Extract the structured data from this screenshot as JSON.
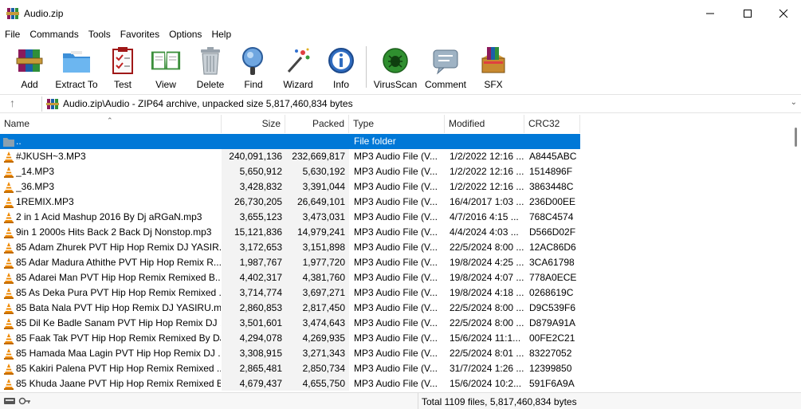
{
  "window": {
    "title": "Audio.zip"
  },
  "menu": [
    "File",
    "Commands",
    "Tools",
    "Favorites",
    "Options",
    "Help"
  ],
  "toolbar": [
    {
      "label": "Add",
      "icon": "add-archive-icon"
    },
    {
      "label": "Extract To",
      "icon": "extract-folder-icon"
    },
    {
      "label": "Test",
      "icon": "test-clipboard-icon"
    },
    {
      "label": "View",
      "icon": "view-book-icon"
    },
    {
      "label": "Delete",
      "icon": "trash-icon"
    },
    {
      "label": "Find",
      "icon": "magnifier-icon"
    },
    {
      "label": "Wizard",
      "icon": "wizard-wand-icon"
    },
    {
      "label": "Info",
      "icon": "info-icon"
    },
    {
      "label": "VirusScan",
      "icon": "virus-scan-icon"
    },
    {
      "label": "Comment",
      "icon": "comment-icon"
    },
    {
      "label": "SFX",
      "icon": "sfx-box-icon"
    }
  ],
  "path": {
    "text": "Audio.zip\\Audio - ZIP64 archive, unpacked size 5,817,460,834 bytes"
  },
  "columns": {
    "name": "Name",
    "size": "Size",
    "packed": "Packed",
    "type": "Type",
    "modified": "Modified",
    "crc": "CRC32"
  },
  "parent_row": {
    "name": "..",
    "type": "File folder"
  },
  "files": [
    {
      "name": "#JKUSH~3.MP3",
      "size": "240,091,136",
      "packed": "232,669,817",
      "type": "MP3 Audio File (V...",
      "modified": "1/2/2022 12:16 ...",
      "crc": "A8445ABC"
    },
    {
      "name": "_14.MP3",
      "size": "5,650,912",
      "packed": "5,630,192",
      "type": "MP3 Audio File (V...",
      "modified": "1/2/2022 12:16 ...",
      "crc": "1514896F"
    },
    {
      "name": "_36.MP3",
      "size": "3,428,832",
      "packed": "3,391,044",
      "type": "MP3 Audio File (V...",
      "modified": "1/2/2022 12:16 ...",
      "crc": "3863448C"
    },
    {
      "name": "1REMIX.MP3",
      "size": "26,730,205",
      "packed": "26,649,101",
      "type": "MP3 Audio File (V...",
      "modified": "16/4/2017 1:03 ...",
      "crc": "236D00EE"
    },
    {
      "name": "2 in 1 Acid Mashup 2016 By Dj aRGaN.mp3",
      "size": "3,655,123",
      "packed": "3,473,031",
      "type": "MP3 Audio File (V...",
      "modified": "4/7/2016 4:15 ...",
      "crc": "768C4574"
    },
    {
      "name": "9in 1 2000s Hits Back 2 Back Dj Nonstop.mp3",
      "size": "15,121,836",
      "packed": "14,979,241",
      "type": "MP3 Audio File (V...",
      "modified": "4/4/2024 4:03 ...",
      "crc": "D566D02F"
    },
    {
      "name": "85 Adam Zhurek PVT Hip Hop Remix DJ YASIR...",
      "size": "3,172,653",
      "packed": "3,151,898",
      "type": "MP3 Audio File (V...",
      "modified": "22/5/2024 8:00 ...",
      "crc": "12AC86D6"
    },
    {
      "name": "85 Adar Madura Athithe PVT Hip Hop Remix R...",
      "size": "1,987,767",
      "packed": "1,977,720",
      "type": "MP3 Audio File (V...",
      "modified": "19/8/2024 4:25 ...",
      "crc": "3CA61798"
    },
    {
      "name": "85 Adarei Man PVT Hip Hop Remix Remixed B...",
      "size": "4,402,317",
      "packed": "4,381,760",
      "type": "MP3 Audio File (V...",
      "modified": "19/8/2024 4:07 ...",
      "crc": "778A0ECE"
    },
    {
      "name": "85 As Deka Pura PVT Hip Hop Remix Remixed ...",
      "size": "3,714,774",
      "packed": "3,697,271",
      "type": "MP3 Audio File (V...",
      "modified": "19/8/2024 4:18 ...",
      "crc": "0268619C"
    },
    {
      "name": "85 Bata Nala PVT Hip Hop Remix DJ YASIRU.mp3",
      "size": "2,860,853",
      "packed": "2,817,450",
      "type": "MP3 Audio File (V...",
      "modified": "22/5/2024 8:00 ...",
      "crc": "D9C539F6"
    },
    {
      "name": "85 Dil Ke Badle Sanam PVT Hip Hop Remix DJ ...",
      "size": "3,501,601",
      "packed": "3,474,643",
      "type": "MP3 Audio File (V...",
      "modified": "22/5/2024 8:00 ...",
      "crc": "D879A91A"
    },
    {
      "name": "85 Faak Tak PVT Hip Hop Remix Remixed By DJ...",
      "size": "4,294,078",
      "packed": "4,269,935",
      "type": "MP3 Audio File (V...",
      "modified": "15/6/2024 11:1...",
      "crc": "00FE2C21"
    },
    {
      "name": "85 Hamada Maa Lagin PVT Hip Hop Remix DJ ...",
      "size": "3,308,915",
      "packed": "3,271,343",
      "type": "MP3 Audio File (V...",
      "modified": "22/5/2024 8:01 ...",
      "crc": "83227052"
    },
    {
      "name": "85 Kakiri Palena PVT Hip Hop Remix Remixed ...",
      "size": "2,865,481",
      "packed": "2,850,734",
      "type": "MP3 Audio File (V...",
      "modified": "31/7/2024 1:26 ...",
      "crc": "12399850"
    },
    {
      "name": "85 Khuda Jaane PVT Hip Hop Remix Remixed B...",
      "size": "4,679,437",
      "packed": "4,655,750",
      "type": "MP3 Audio File (V...",
      "modified": "15/6/2024 10:2...",
      "crc": "591F6A9A"
    }
  ],
  "status": {
    "text": "Total 1109 files, 5,817,460,834 bytes"
  },
  "colors": {
    "selection": "#0078d7",
    "vlc_orange": "#f08a00",
    "folder": "#8aa0b0"
  }
}
